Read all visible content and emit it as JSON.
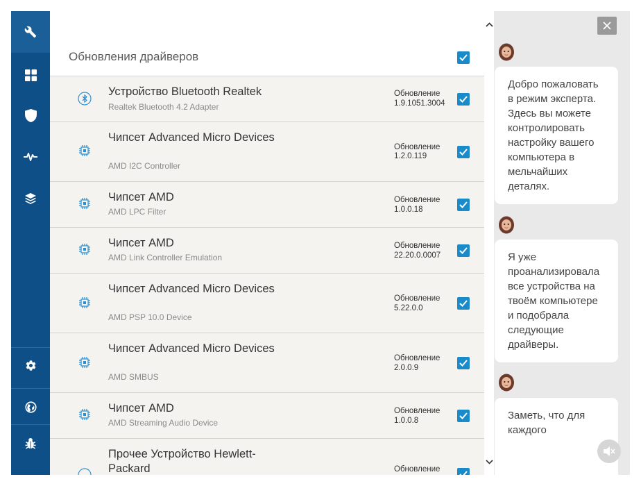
{
  "sidebar": {
    "items": [
      {
        "icon": "wrench-icon"
      },
      {
        "icon": "grid-icon"
      },
      {
        "icon": "shield-icon"
      },
      {
        "icon": "pulse-icon"
      },
      {
        "icon": "layers-icon"
      }
    ],
    "bottom_items": [
      {
        "icon": "gear-icon"
      },
      {
        "icon": "globe-icon"
      },
      {
        "icon": "bug-icon"
      }
    ]
  },
  "main": {
    "section_title": "Обновления драйверов",
    "update_label": "Обновление",
    "drivers": [
      {
        "name": "Устройство Bluetooth Realtek",
        "sub": "Realtek Bluetooth 4.2 Adapter",
        "version": "1.9.1051.3004",
        "icon": "bluetooth-icon",
        "checked": true
      },
      {
        "name": "Чипсет Advanced Micro Devices",
        "sub": "AMD I2C Controller",
        "version": "1.2.0.119",
        "icon": "chip-icon",
        "checked": true
      },
      {
        "name": "Чипсет AMD",
        "sub": "AMD LPC Filter",
        "version": "1.0.0.18",
        "icon": "chip-icon",
        "checked": true
      },
      {
        "name": "Чипсет AMD",
        "sub": "AMD Link Controller Emulation",
        "version": "22.20.0.0007",
        "icon": "chip-icon",
        "checked": true
      },
      {
        "name": "Чипсет Advanced Micro Devices",
        "sub": "AMD PSP 10.0 Device",
        "version": "5.22.0.0",
        "icon": "chip-icon",
        "checked": true
      },
      {
        "name": "Чипсет Advanced Micro Devices",
        "sub": "AMD SMBUS",
        "version": "2.0.0.9",
        "icon": "chip-icon",
        "checked": true
      },
      {
        "name": "Чипсет AMD",
        "sub": "AMD Streaming Audio Device",
        "version": "1.0.0.8",
        "icon": "chip-icon",
        "checked": true
      },
      {
        "name": "Прочее Устройство Hewlett-Packard",
        "sub": "",
        "version": "",
        "icon": "device-icon",
        "checked": true
      }
    ]
  },
  "chat": {
    "messages": [
      "Добро пожаловать в режим эксперта. Здесь вы можете контролировать настройку вашего компьютера в мельчайших деталях.",
      "Я уже проанализировала все устройства на твоём компьютере и подобрала следующие драйверы.",
      "Заметь, что для каждого"
    ]
  },
  "colors": {
    "sidebar": "#0d4f86",
    "checkbox": "#1a8ac9",
    "row_bg": "#f4f3f0",
    "chat_bg": "#e9e9e9"
  }
}
